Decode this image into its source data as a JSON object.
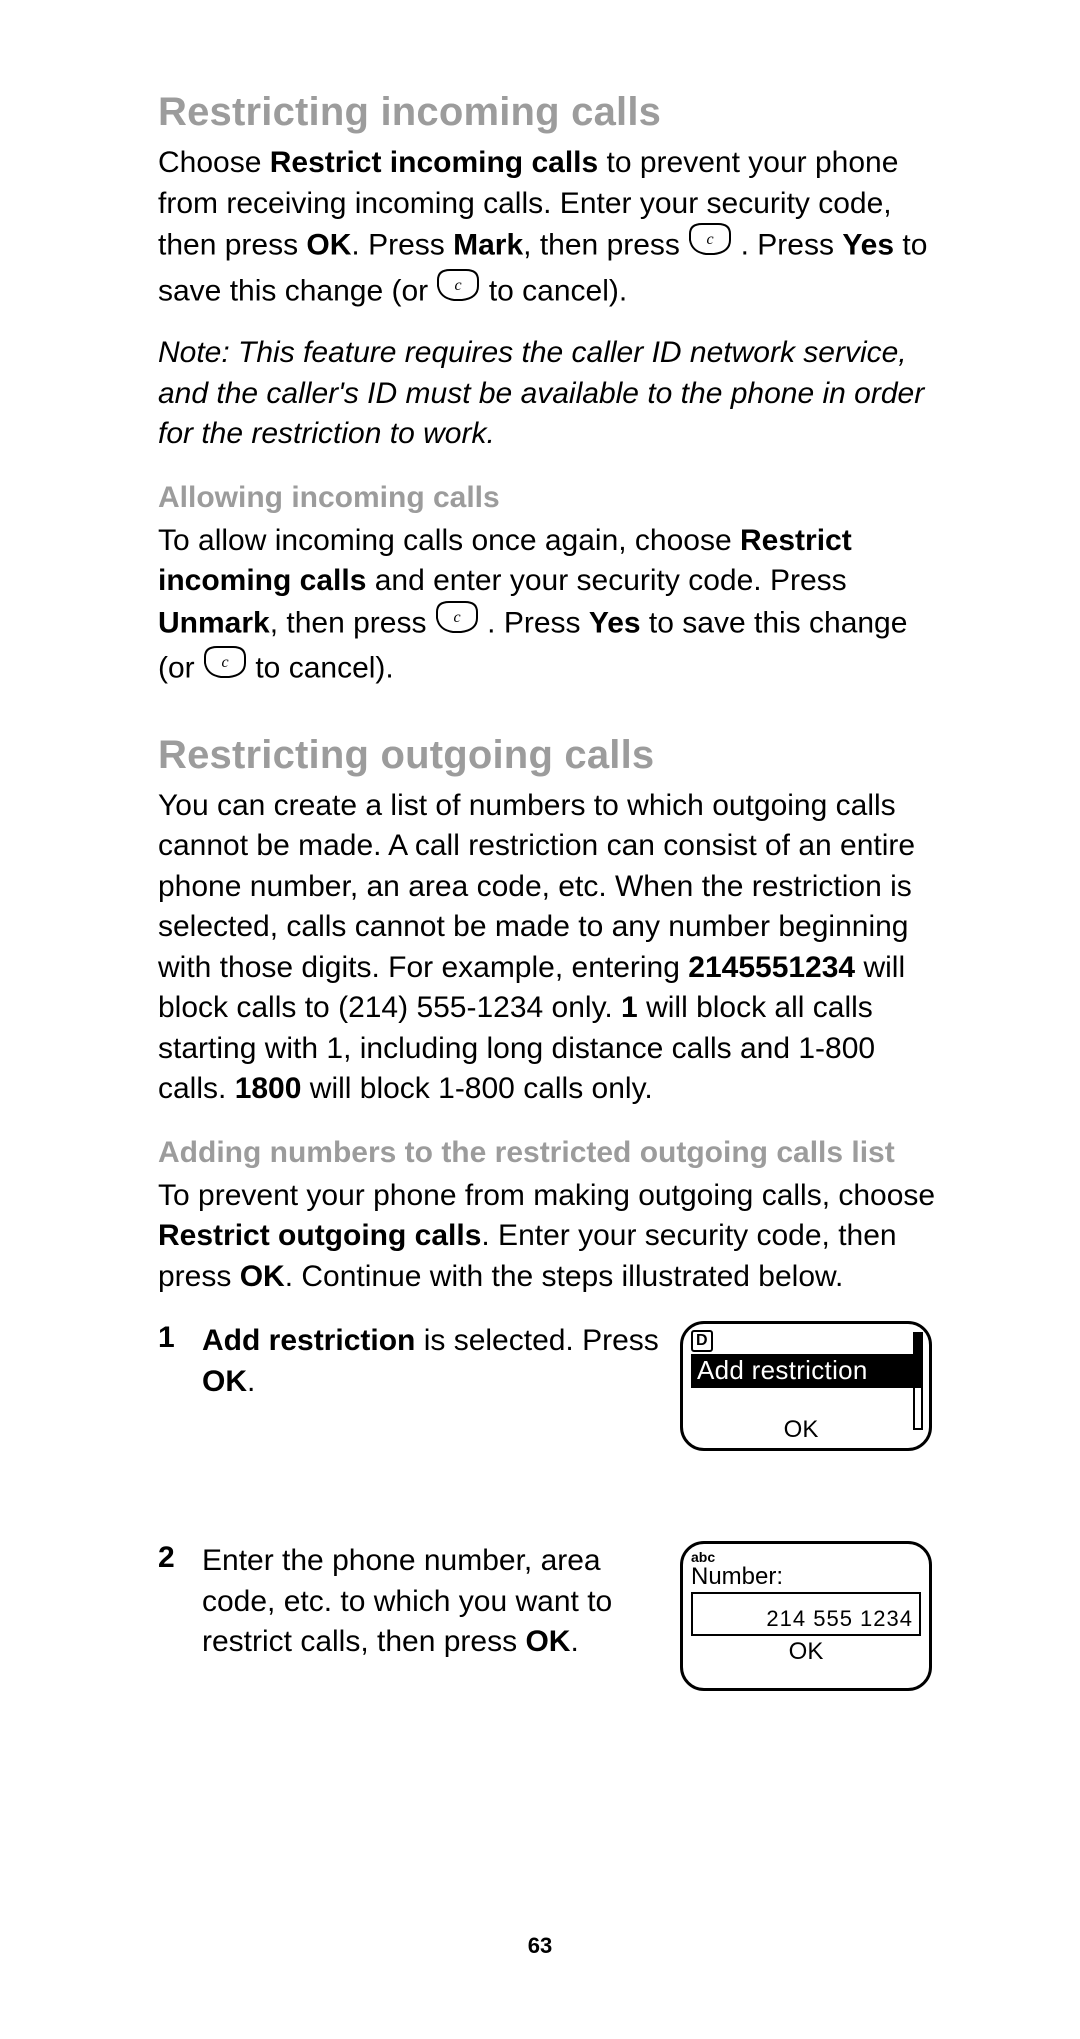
{
  "page_number": "63",
  "s1": {
    "title": "Restricting incoming calls",
    "p1a": "Choose ",
    "p1b": "Restrict incoming calls",
    "p1c": " to prevent your phone from receiving incoming calls. Enter your security code, then press ",
    "p1d": "OK",
    "p1e": ". Press ",
    "p1f": "Mark",
    "p1g": ", then press ",
    "p1h": ". Press ",
    "p1i": "Yes",
    "p1j": " to save this change (or ",
    "p1k": " to cancel).",
    "note": "Note:  This feature requires the caller ID network service, and the caller's ID must be available to the phone in order for the restriction to work.",
    "sub_title": "Allowing incoming calls",
    "p2a": "To allow incoming calls once again, choose ",
    "p2b": "Restrict incoming calls",
    "p2c": " and enter your security code. Press ",
    "p2d": "Unmark",
    "p2e": ", then press ",
    "p2f": ". Press ",
    "p2g": "Yes",
    "p2h": " to save this change (or ",
    "p2i": " to cancel)."
  },
  "s2": {
    "title": "Restricting outgoing calls",
    "p1a": "You can create a list of numbers to which outgoing calls cannot be made. A call restriction can consist of an entire phone number, an area code, etc. When the restriction is selected, calls cannot be made to any number beginning with those digits. For example, entering ",
    "p1b": "2145551234",
    "p1c": " will block calls to (214) 555-1234 only. ",
    "p1d": "1",
    "p1e": " will block all calls starting with 1, including long distance calls and 1-800 calls. ",
    "p1f": "1800",
    "p1g": " will block 1-800 calls only.",
    "sub_title": "Adding numbers to the restricted outgoing calls list",
    "p2a": "To prevent your phone from making outgoing calls, choose ",
    "p2b": "Restrict outgoing calls",
    "p2c": ". Enter your security code, then press ",
    "p2d": "OK",
    "p2e": ". Continue with the steps illustrated below."
  },
  "steps": {
    "s1": {
      "num": "1",
      "a": "Add restriction",
      "b": " is selected. Press ",
      "c": "OK",
      "d": "."
    },
    "s2": {
      "num": "2",
      "a": "Enter the phone number, area code, etc. to which you want to restrict calls, then press ",
      "b": "OK",
      "c": "."
    }
  },
  "fig1": {
    "indicator": "D",
    "highlight": "Add restriction",
    "ok": "OK"
  },
  "fig2": {
    "mode": "abc",
    "label": "Number:",
    "value": "214 555 1234",
    "ok": "OK"
  },
  "icon_c_letter": "c"
}
